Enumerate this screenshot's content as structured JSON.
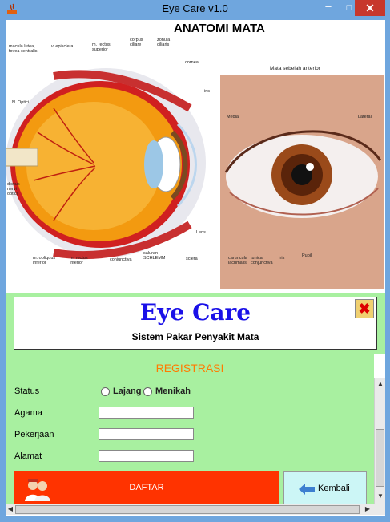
{
  "window": {
    "title": "Eye Care v1.0",
    "controls": {
      "minimize": "–",
      "maximize": "□",
      "close": "✕"
    }
  },
  "anatomy": {
    "title": "ANATOMI MATA",
    "labels": {
      "macula": "macula lutea,\nfovea centralis",
      "episclera": "v. episclera",
      "rectus_superior": "m. rectus\nsuperior",
      "corpus_ciliare": "corpus\nciliare",
      "zonula": "zonula\nciliaris",
      "cornea": "cornea",
      "iris_left": "iris",
      "n_optici": "N. Optici",
      "discus": "discus\nnervi\noptici",
      "obliquus": "m. obliquus\ninferior",
      "rectus_inferior": "m. rectus\ninferior",
      "conjunctiva": "conjunctiva",
      "schlemm": "saluran\nSCHLEMM",
      "sclera": "sclera",
      "lens": "Lens",
      "anterior_title": "Mata sebelah anterior",
      "medial": "Medial",
      "lateral": "Lateral",
      "caruncula": "caruncula\nlacrimalis",
      "tunica": "tunica\nconjunctiva",
      "iris_right": "Iris",
      "pupil": "Pupil"
    }
  },
  "banner": {
    "title": "Eye Care",
    "subtitle": "Sistem Pakar Penyakit Mata",
    "exit_icon": "close-x-icon"
  },
  "form": {
    "section_title": "REGISTRASI",
    "status_label": "Status",
    "status_options": [
      "Lajang",
      "Menikah"
    ],
    "agama_label": "Agama",
    "agama_value": "",
    "pekerjaan_label": "Pekerjaan",
    "pekerjaan_value": "",
    "alamat_label": "Alamat",
    "alamat_value": "",
    "daftar_label": "DAFTAR",
    "kembali_label": "Kembali"
  },
  "colors": {
    "title_bar": "#6fa6de",
    "panel_bg": "#a8f0a0",
    "banner_title": "#1a10e8",
    "section_title": "#ff7a00",
    "daftar_bg": "#ff3300",
    "kembali_bg": "#ccf6f6"
  }
}
